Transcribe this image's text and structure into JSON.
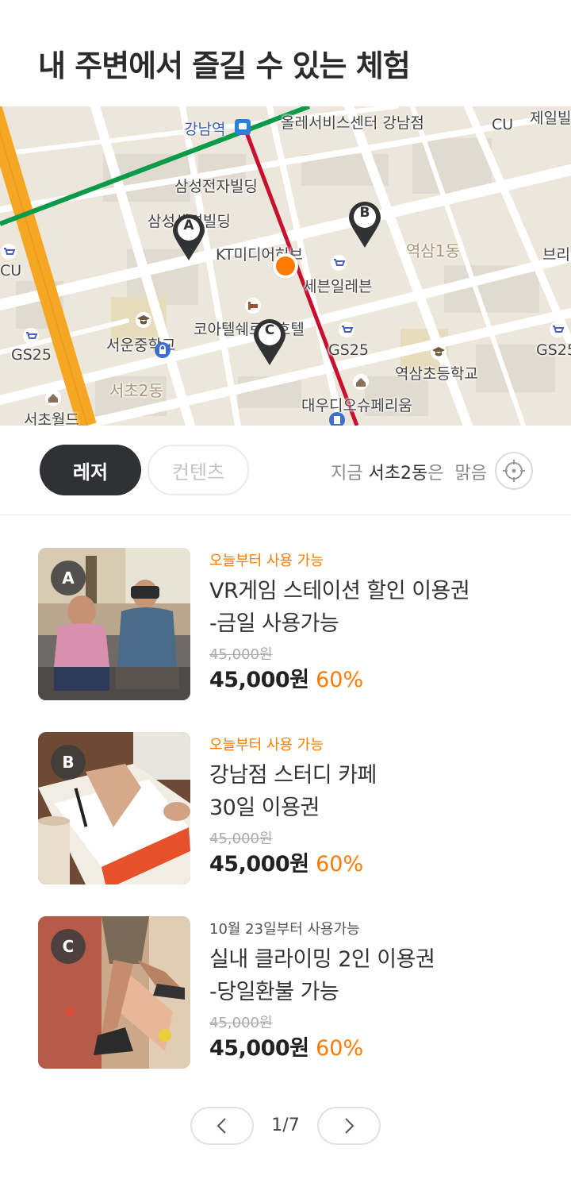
{
  "header": {
    "title": "내 주변에서 즐길 수 있는 체험"
  },
  "map": {
    "labels": {
      "gangnam_station": "강남역",
      "olleh": "올레서비스센터 강남점",
      "cu_top": "CU",
      "jeil": "제일빌",
      "samsung_electronics": "삼성전자빌딩",
      "samsung_life": "삼성생명빌딩",
      "kt_media": "KT미디어허브",
      "yeoksam1": "역삼1동",
      "bri": "브리",
      "cu_left": "CU",
      "seven_eleven": "세븐일레븐",
      "coatel": "코아텔쉐르빌호텔",
      "seoun_school": "서운중학교",
      "gs25_left": "GS25",
      "gs25_mid": "GS25",
      "gs25_right": "GS25",
      "yeoksam_school": "역삼초등학교",
      "seocho2": "서초2동",
      "daewoo": "대우디오슈페리움",
      "seocho_world": "서초월드"
    },
    "pins": [
      "A",
      "B",
      "C"
    ]
  },
  "filters": {
    "categories": [
      {
        "label": "레저",
        "active": true
      },
      {
        "label": "컨텐츠",
        "active": false
      }
    ],
    "weather": {
      "prefix": "지금",
      "location": "서초2동",
      "suffix": "은",
      "condition": "맑음"
    }
  },
  "products": [
    {
      "badge": "A",
      "availability": "오늘부터 사용 가능",
      "name_line1": "VR게임 스테이션 할인 이용권",
      "name_line2": "-금일 사용가능",
      "original_price": "45,000원",
      "price": "45,000원",
      "discount": "60%"
    },
    {
      "badge": "B",
      "availability": "오늘부터 사용 가능",
      "name_line1": "강남점 스터디 카페",
      "name_line2": "30일 이용권",
      "original_price": "45,000원",
      "price": "45,000원",
      "discount": "60%"
    },
    {
      "badge": "C",
      "availability": "10월 23일부터 사용가능",
      "name_line1": "실내 클라이밍 2인 이용권",
      "name_line2": "-당일환불 가능",
      "original_price": "45,000원",
      "price": "45,000원",
      "discount": "60%"
    }
  ],
  "pagination": {
    "current": "1/7"
  },
  "colors": {
    "accent": "#ff7a00",
    "dark": "#2f3135",
    "subway_green": "#0a9a4a",
    "subway_red": "#c8102e",
    "road_orange": "#f5a623"
  }
}
